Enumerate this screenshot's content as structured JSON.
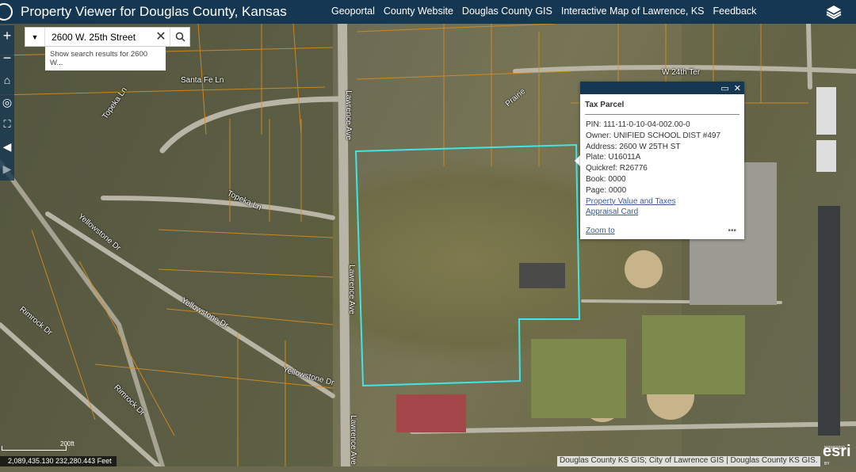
{
  "header": {
    "title": "Property Viewer for Douglas County, Kansas",
    "nav": [
      "Geoportal",
      "County Website",
      "Douglas County GIS",
      "Interactive Map of Lawrence, KS",
      "Feedback"
    ]
  },
  "search": {
    "value": "2600 W. 25th Street",
    "suggestion": "Show search results for 2600 W..."
  },
  "controls": [
    "zoom-in",
    "zoom-out",
    "home",
    "locate",
    "fullscreen",
    "back",
    "forward"
  ],
  "streets": [
    "Santa Fe Ln",
    "Topeka Ln",
    "Topeka Ln",
    "Yellowstone Dr",
    "Yellowstone Dr",
    "Yellowstone Dr",
    "Rimrock Dr",
    "Rimrock Dr",
    "Lawrence Ave",
    "Lawrence Ave",
    "Lawrence Ave",
    "W 24th Ter",
    "Prairie"
  ],
  "popup": {
    "title": "Tax Parcel",
    "fields": [
      "PIN: 111-11-0-10-04-002.00-0",
      "Owner: UNIFIED SCHOOL DIST #497",
      "Address: 2600 W 25TH ST",
      "Plate: U16011A",
      "Quickref: R26776",
      "Book: 0000",
      "Page: 0000"
    ],
    "links": [
      "Property Value and Taxes",
      "Appraisal Card"
    ],
    "zoom_to": "Zoom to",
    "more": "•••"
  },
  "scale": "200ft",
  "coordinates": "2,089,435.130 232,280.443 Feet",
  "attribution": "Douglas County KS GIS; City of Lawrence GIS | Douglas County KS GIS.",
  "esri": {
    "powered": "POWERED BY",
    "brand": "esri"
  },
  "colors": {
    "header": "#153751",
    "parcel_highlight": "#3ee6e6",
    "parcel_lines": "#d98c1f"
  }
}
